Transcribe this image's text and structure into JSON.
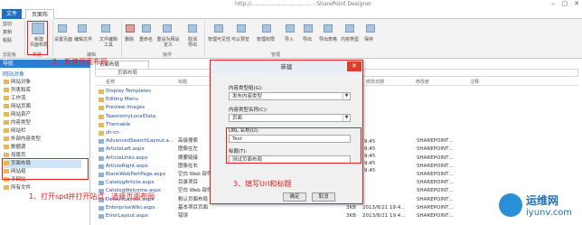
{
  "window": {
    "title": "http://…………………………… - SharePoint Designer"
  },
  "tabs": {
    "file": "文件",
    "active": "页面布局"
  },
  "ribbon": {
    "clipboard": [
      "剪切",
      "复制",
      "粘贴"
    ],
    "new_button": "新建\n页面布局",
    "buttons": [
      "设置页面",
      "编辑文件",
      "文件编辑\n工具",
      "删除",
      "重命名",
      "重设为网站\n定义",
      "取消\n导出",
      "管理可见性",
      "可以预览",
      "管理权限",
      "导入",
      "导出",
      "导出表格",
      "内容类型",
      "保存"
    ],
    "groups": [
      "剪贴板",
      "新建",
      "编辑",
      "操作",
      "管理"
    ]
  },
  "nav": {
    "header": "导航",
    "subheader": "网站对象",
    "items": [
      "网站对象",
      "列表和库",
      "工作流",
      "网站页面",
      "网站资产",
      "内容类型",
      "网站栏",
      "外部内容类型",
      "数据源",
      "母版页",
      "页面布局",
      "网站组",
      "子网站",
      "所有文件"
    ]
  },
  "content": {
    "tab": "页面布局",
    "breadcrumb": "页面布局",
    "columns": [
      "名称",
      "标题",
      "类型",
      "大小",
      "修改日期",
      "修改者",
      "注释"
    ],
    "rows": [
      {
        "name": "Display Templates",
        "title": "",
        "size": "",
        "date": "",
        "by": "",
        "folder": true
      },
      {
        "name": "Editing Menu",
        "title": "",
        "size": "",
        "date": "",
        "by": "",
        "folder": true
      },
      {
        "name": "Preview Images",
        "title": "",
        "size": "",
        "date": "",
        "by": "",
        "folder": true
      },
      {
        "name": "TaxonomyLocalData",
        "title": "",
        "size": "",
        "date": "",
        "by": "",
        "folder": true
      },
      {
        "name": "Themable",
        "title": "",
        "size": "",
        "date": "",
        "by": "",
        "folder": true
      },
      {
        "name": "zh-cn",
        "title": "",
        "size": "",
        "date": "",
        "by": "",
        "folder": true
      },
      {
        "name": "AdvancedSearchLayout.a…",
        "title": "高级搜索",
        "size": "",
        "date": "",
        "by": "SHAREPOINT…",
        "folder": false
      },
      {
        "name": "ArticleLeft.aspx",
        "title": "图像在左",
        "size": "",
        "date": "",
        "by": "SHAREPOINT…",
        "folder": false
      },
      {
        "name": "ArticleLinks.aspx",
        "title": "摘要链接",
        "size": "",
        "date": "",
        "by": "SHAREPOINT…",
        "folder": false
      },
      {
        "name": "ArticleRight.aspx",
        "title": "图像在右",
        "size": "",
        "date": "",
        "by": "SHAREPOINT…",
        "folder": false
      },
      {
        "name": "BlankWebPartPage.aspx",
        "title": "空白 Web 部件页",
        "size": "",
        "date": "",
        "by": "SHAREPOINT…",
        "folder": false
      },
      {
        "name": "CatalogArticle.aspx",
        "title": "目录项目",
        "size": "",
        "date": "",
        "by": "SHAREPOINT…",
        "folder": false
      },
      {
        "name": "CatalogWelcome.aspx",
        "title": "空白 Web 部件页",
        "size": "",
        "date": "",
        "by": "SHAREPOINT…",
        "folder": false
      },
      {
        "name": "DefaultLayout.aspx",
        "title": "默认页面布局",
        "size": "",
        "date": "",
        "by": "SHAREPOINT…",
        "folder": false
      },
      {
        "name": "EnterpriseWiki.aspx",
        "title": "基本项目页面",
        "size": "3KB",
        "date": "2013/8/21 19:4…",
        "by": "SHAREPOINT…",
        "folder": false
      },
      {
        "name": "ErrorLayout.aspx",
        "title": "错误",
        "size": "3KB",
        "date": "2013/8/21 19:4…",
        "by": "SHAREPOINT…",
        "folder": false
      }
    ],
    "times": [
      "9:45",
      "9:45",
      "9:45",
      "9:45",
      "9:45"
    ]
  },
  "dialog": {
    "title": "新建",
    "group_label": "内容类型组(G):",
    "group_value": "发布内容类型",
    "type_label": "内容类型名称(C):",
    "type_value": "页面",
    "url_label": "URL 名称(U):",
    "url_value": "Test",
    "title_label": "标题(T):",
    "title_value": "测试页面布局",
    "ok": "确定",
    "cancel": "取消"
  },
  "annotations": {
    "step1": "1、打开spd并打开站点，选择页面布局",
    "step2": "2、新建页面布局",
    "step3": "3、填写Url和标题"
  },
  "watermark": {
    "brand": "运维网",
    "url": "iyunv.com"
  },
  "colors": {
    "accent": "#1e6fbf",
    "annotation": "#e52020",
    "folder": "#e7b85a"
  }
}
